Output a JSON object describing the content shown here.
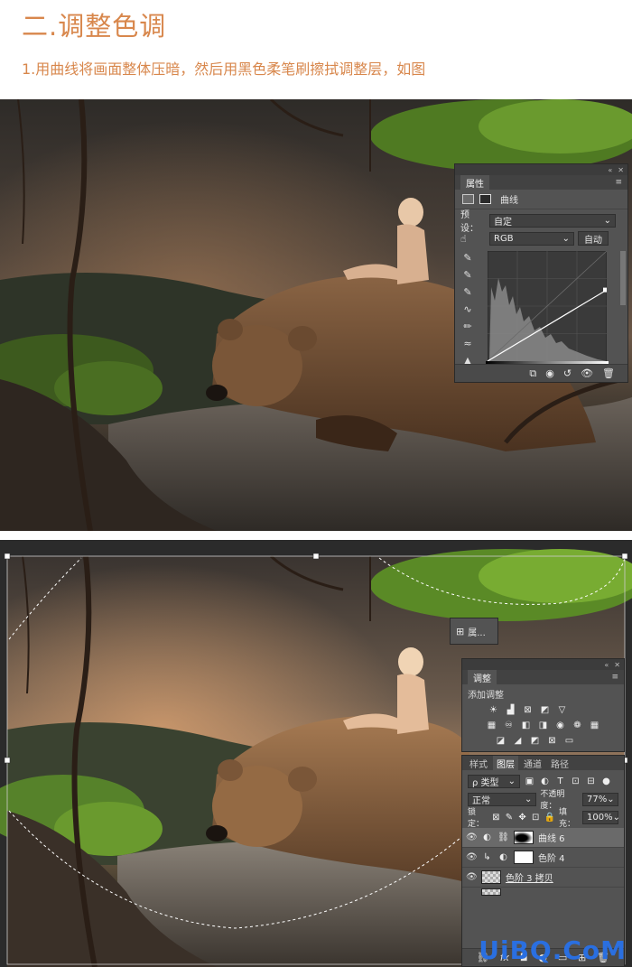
{
  "article": {
    "heading": "二.调整色调",
    "step": "1.用曲线将画面整体压暗，然后用黑色柔笔刷擦拭调整层，如图"
  },
  "colors": {
    "heading_orange": "#d8874c",
    "ps_panel_gray": "#535353",
    "ps_dark": "#3c3c3c",
    "watermark_blue": "#2a6fe0"
  },
  "properties_panel": {
    "tab": "属性",
    "title": "曲线",
    "preset_label": "预设：",
    "preset_value": "自定",
    "channel_value": "RGB",
    "auto_button": "自动",
    "curve_points": [
      [
        0,
        0
      ],
      [
        255,
        165
      ]
    ],
    "icons": [
      "curves-adjustment-icon",
      "mask-icon",
      "hand-adjust-icon",
      "eyedropper-black-icon",
      "eyedropper-gray-icon",
      "eyedropper-white-icon",
      "curve-point-tool-icon",
      "pencil-tool-icon",
      "smooth-icon",
      "clipping-warning-icon",
      "clip-to-layer-icon",
      "view-previous-icon",
      "reset-icon",
      "visibility-icon",
      "delete-icon"
    ]
  },
  "mini_panel": {
    "label": "属..."
  },
  "adjustments_panel": {
    "tab": "调整",
    "subtitle": "添加调整",
    "icon_rows": [
      [
        "brightness-icon",
        "levels-icon",
        "curves-icon",
        "exposure-icon",
        "triangle-icon"
      ],
      [
        "vibrance-icon",
        "hue-saturation-icon",
        "color-balance-icon",
        "black-white-icon",
        "photo-filter-icon",
        "channel-mixer-icon",
        "color-lookup-icon"
      ],
      [
        "invert-icon",
        "posterize-icon",
        "threshold-icon",
        "selective-color-icon",
        "gradient-map-icon"
      ]
    ]
  },
  "layers_panel": {
    "tabs": [
      "样式",
      "图层",
      "通道",
      "路径"
    ],
    "active_tab": "图层",
    "filter_label": "ρ 类型",
    "blend_mode": "正常",
    "opacity_label": "不透明度：",
    "opacity_value": "77%",
    "lock_label": "锁定：",
    "fill_label": "填充：",
    "fill_value": "100%",
    "layers": [
      {
        "name": "曲线 6",
        "thumb": "mask",
        "selected": true
      },
      {
        "name": "色阶 4",
        "thumb": "white",
        "selected": false
      },
      {
        "name": "色阶 3 拷贝",
        "thumb": "checker",
        "selected": false
      }
    ],
    "footer_icons": [
      "link-icon",
      "fx-icon",
      "add-mask-icon",
      "new-adjustment-icon",
      "new-group-icon",
      "new-layer-icon",
      "trash-icon"
    ],
    "footer_fx": "fx"
  },
  "watermark": "UiBQ.CoM"
}
